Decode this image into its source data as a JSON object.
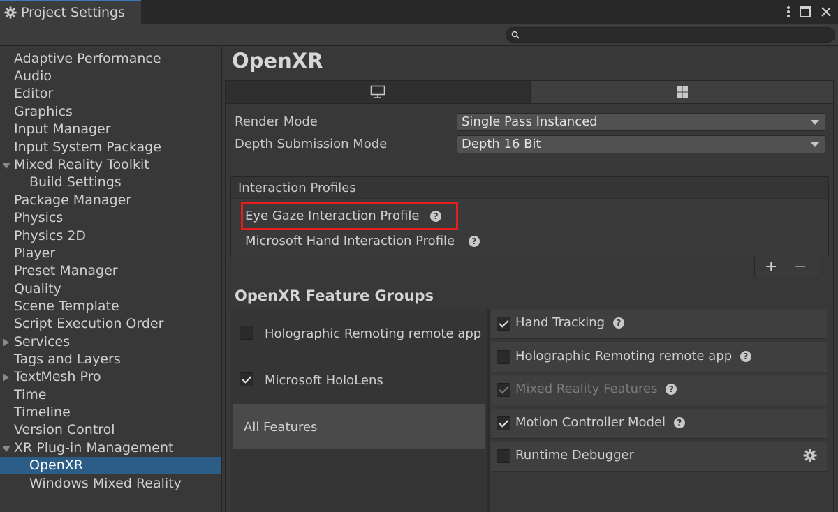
{
  "window": {
    "title": "Project Settings",
    "tab_icon": "gear-icon"
  },
  "search": {
    "placeholder": ""
  },
  "sidebar": {
    "items": [
      {
        "label": "Adaptive Performance"
      },
      {
        "label": "Audio"
      },
      {
        "label": "Editor"
      },
      {
        "label": "Graphics"
      },
      {
        "label": "Input Manager"
      },
      {
        "label": "Input System Package"
      },
      {
        "label": "Mixed Reality Toolkit",
        "expanded": true
      },
      {
        "label": "Build Settings",
        "child": true
      },
      {
        "label": "Package Manager"
      },
      {
        "label": "Physics"
      },
      {
        "label": "Physics 2D"
      },
      {
        "label": "Player"
      },
      {
        "label": "Preset Manager"
      },
      {
        "label": "Quality"
      },
      {
        "label": "Scene Template"
      },
      {
        "label": "Script Execution Order"
      },
      {
        "label": "Services",
        "collapsed": true
      },
      {
        "label": "Tags and Layers"
      },
      {
        "label": "TextMesh Pro",
        "collapsed": true
      },
      {
        "label": "Time"
      },
      {
        "label": "Timeline"
      },
      {
        "label": "Version Control"
      },
      {
        "label": "XR Plug-in Management",
        "expanded": true
      },
      {
        "label": "OpenXR",
        "child": true,
        "selected": true
      },
      {
        "label": "Windows Mixed Reality",
        "child": true
      }
    ]
  },
  "main": {
    "title": "OpenXR",
    "platform_tabs": [
      {
        "icon": "desktop-icon",
        "selected": false
      },
      {
        "icon": "windows-icon",
        "selected": true
      }
    ],
    "render_mode": {
      "label": "Render Mode",
      "value": "Single Pass Instanced"
    },
    "depth_submission": {
      "label": "Depth Submission Mode",
      "value": "Depth 16 Bit"
    },
    "interaction_profiles": {
      "title": "Interaction Profiles",
      "items": [
        {
          "label": "Eye Gaze Interaction Profile",
          "highlighted": true
        },
        {
          "label": "Microsoft Hand Interaction Profile"
        }
      ],
      "add": "+",
      "remove": "−"
    },
    "feature_groups": {
      "title": "OpenXR Feature Groups",
      "groups": [
        {
          "label": "Holographic Remoting remote app",
          "checked": false
        },
        {
          "label": "Microsoft HoloLens",
          "checked": true
        },
        {
          "label": "All Features",
          "selected": true
        }
      ],
      "features": [
        {
          "label": "Hand Tracking",
          "checked": true,
          "help": true
        },
        {
          "label": "Holographic Remoting remote app",
          "checked": false,
          "help": true
        },
        {
          "label": "Mixed Reality Features",
          "checked": true,
          "disabled": true,
          "help": true
        },
        {
          "label": "Motion Controller Model",
          "checked": true,
          "help": true
        },
        {
          "label": "Runtime Debugger",
          "checked": false,
          "settings": true
        }
      ]
    },
    "help_glyph": "?"
  },
  "colors": {
    "accent": "#2c5d87",
    "highlight_border": "#e41e1e",
    "background": "#383838"
  }
}
